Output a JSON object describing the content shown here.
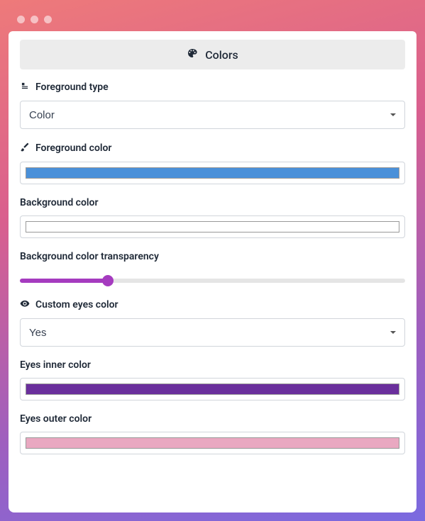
{
  "accent": "#a53bbf",
  "header": {
    "title": "Colors"
  },
  "fields": {
    "foreground_type": {
      "label": "Foreground type",
      "value": "Color",
      "options": [
        "Color"
      ]
    },
    "foreground_color": {
      "label": "Foreground color",
      "value": "#4a90d9"
    },
    "background_color": {
      "label": "Background color",
      "value": "#ffffff"
    },
    "bg_transparency": {
      "label": "Background color transparency",
      "value": 22,
      "min": 0,
      "max": 100
    },
    "custom_eyes": {
      "label": "Custom eyes color",
      "value": "Yes",
      "options": [
        "Yes"
      ]
    },
    "eyes_inner": {
      "label": "Eyes inner color",
      "value": "#6a2f9c"
    },
    "eyes_outer": {
      "label": "Eyes outer color",
      "value": "#e9a8c1"
    }
  }
}
